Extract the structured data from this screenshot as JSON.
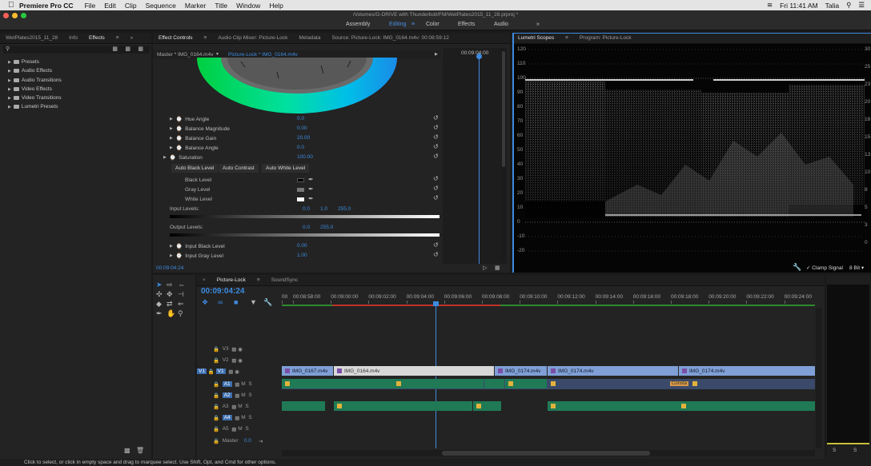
{
  "menubar": {
    "app": "Premiere Pro CC",
    "items": [
      "File",
      "Edit",
      "Clip",
      "Sequence",
      "Marker",
      "Title",
      "Window",
      "Help"
    ],
    "clock": "Fri 11:41 AM",
    "user": "Talia"
  },
  "window": {
    "path": "/Volumes/G-DRIVE with Thunderbolt/FM/WetPlates2015_11_28.prproj *",
    "workspaces": [
      "Assembly",
      "Editing",
      "Color",
      "Effects",
      "Audio"
    ],
    "active_workspace": "Editing"
  },
  "left_panel": {
    "tabs": [
      "WetPlates2015_11_28",
      "Info",
      "Effects"
    ],
    "active_tab": "Effects",
    "tree": [
      "Presets",
      "Audio Effects",
      "Audio Transitions",
      "Video Effects",
      "Video Transitions",
      "Lumetri Presets"
    ]
  },
  "effect_controls": {
    "tabs": [
      "Effect Controls",
      "Audio Clip Mixer: Picture-Lock",
      "Metadata",
      "Source: Picture-Lock: IMG_0164.m4v: 00:08:59:12"
    ],
    "master": "Master * IMG_0164.m4v",
    "sequence": "Picture-Lock * IMG_0164.m4v",
    "header_tc": "00:09:04:00",
    "params": [
      {
        "label": "Hue Angle",
        "value": "0.0"
      },
      {
        "label": "Balance Magnitude",
        "value": "0.00"
      },
      {
        "label": "Balance Gain",
        "value": "20.00"
      },
      {
        "label": "Balance Angle",
        "value": "0.0"
      },
      {
        "label": "Saturation",
        "value": "100.00"
      }
    ],
    "auto_buttons": [
      "Auto Black Level",
      "Auto Contrast",
      "Auto White Level"
    ],
    "levels": [
      "Black Level",
      "Gray Level",
      "White Level"
    ],
    "input_levels_label": "Input Levels:",
    "input_levels": [
      "0.0",
      "1.0",
      "255.0"
    ],
    "output_levels_label": "Output Levels:",
    "output_levels": [
      "0.0",
      "255.0"
    ],
    "bottom_params": [
      {
        "label": "Input Black Level",
        "value": "0.00"
      },
      {
        "label": "Input Gray Level",
        "value": "1.00"
      }
    ],
    "timecode": "00:09:04:24"
  },
  "scopes": {
    "tabs": [
      "Lumetri Scopes",
      "Program: Picture-Lock"
    ],
    "y_labels": [
      "120",
      "110",
      "100",
      "90",
      "80",
      "70",
      "60",
      "50",
      "40",
      "30",
      "20",
      "10",
      "0",
      "-10",
      "-20"
    ],
    "y_labels_right": [
      "30",
      "25",
      "23",
      "20",
      "18",
      "15",
      "13",
      "10",
      "8",
      "5",
      "3",
      "0"
    ],
    "clamp_label": "Clamp Signal",
    "bit_depth": "8 Bit"
  },
  "timeline": {
    "tabs": [
      "Picture-Lock",
      "SoundSync"
    ],
    "timecode": "00:09:04:24",
    "ruler": [
      "00",
      "00:08:58:00",
      "00:09:00:00",
      "00:09:02:00",
      "00:09:04:00",
      "00:09:06:00",
      "00:09:08:00",
      "00:09:10:00",
      "00:09:12:00",
      "00:09:14:00",
      "00:09:16:00",
      "00:09:18:00",
      "00:09:20:00",
      "00:09:22:00",
      "00:09:24:00"
    ],
    "tracks": [
      "V3",
      "V2",
      "V1",
      "A1",
      "A2",
      "A3",
      "A4",
      "A5"
    ],
    "master_label": "Master",
    "master_value": "0.0",
    "clips": {
      "v1": [
        "IMG_0167.m4v",
        "IMG_0164.m4v",
        "IMG_0174.m4v",
        "IMG_0174.m4v",
        "IMG_0174.m4v"
      ],
      "audio_label": "Consta"
    }
  },
  "meter": {
    "labels": [
      "S",
      "S"
    ]
  },
  "status": "Click to select, or click in empty space and drag to marquee select. Use Shift, Opt, and Cmd for other options."
}
